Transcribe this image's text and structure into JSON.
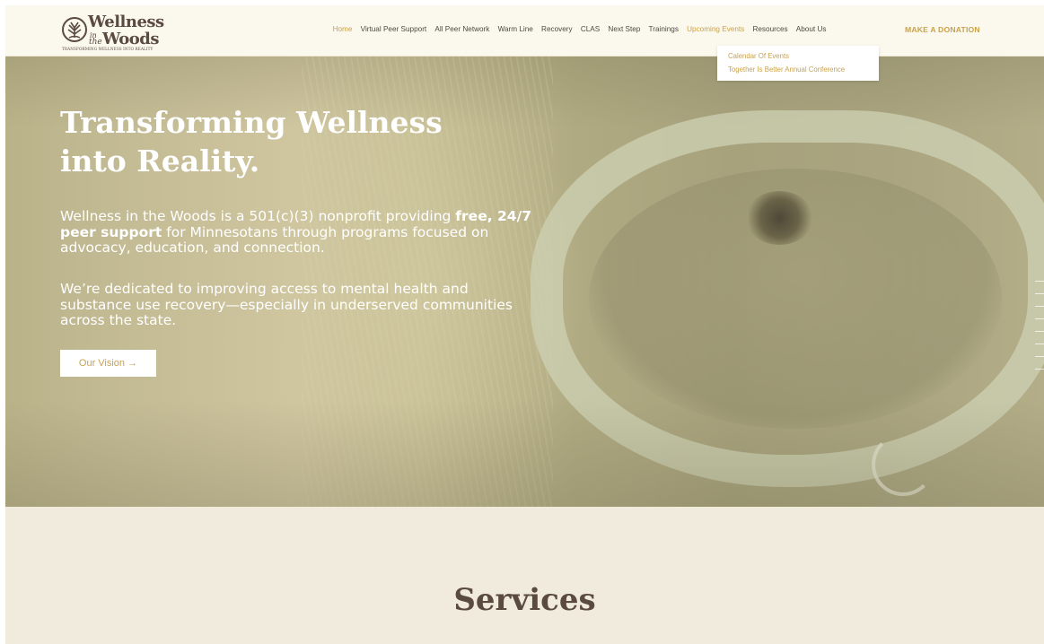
{
  "header": {
    "logo": {
      "line1": "Wellness",
      "in": "in",
      "the": "the",
      "line2": "Woods",
      "tagline": "TRANSFORMING WELLNESS INTO REALITY"
    },
    "nav": [
      {
        "label": "Home"
      },
      {
        "label": "Virtual Peer Support"
      },
      {
        "label": "All Peer Network"
      },
      {
        "label": "Warm Line"
      },
      {
        "label": "Recovery"
      },
      {
        "label": "CLAS"
      },
      {
        "label": "Next Step"
      },
      {
        "label": "Trainings"
      },
      {
        "label": "Upcoming Events"
      },
      {
        "label": "Resources"
      },
      {
        "label": "About Us"
      }
    ],
    "donate_label": "MAKE A DONATION",
    "dropdown": [
      {
        "label": "Calendar Of Events"
      },
      {
        "label": "Together Is Better Annual Conference"
      }
    ]
  },
  "hero": {
    "title_line1": "Transforming Wellness",
    "title_line2": "into Reality.",
    "p1_a": "Wellness in the Woods is a 501(c)(3) nonprofit providing ",
    "p1_bold": "free, 24/7 peer support",
    "p1_b": " for Minnesotans through programs focused on advocacy, education,  and connection.",
    "p2": "We’re dedicated to improving access to mental health and substance use recovery—especially in underserved communities across the state.",
    "button_label": "Our Vision →"
  },
  "services": {
    "title": "Services"
  },
  "colors": {
    "accent": "#c9a24c",
    "brand_brown": "#5b4a40",
    "header_bg": "#fbf8ee",
    "services_bg": "#f0ebdd"
  }
}
